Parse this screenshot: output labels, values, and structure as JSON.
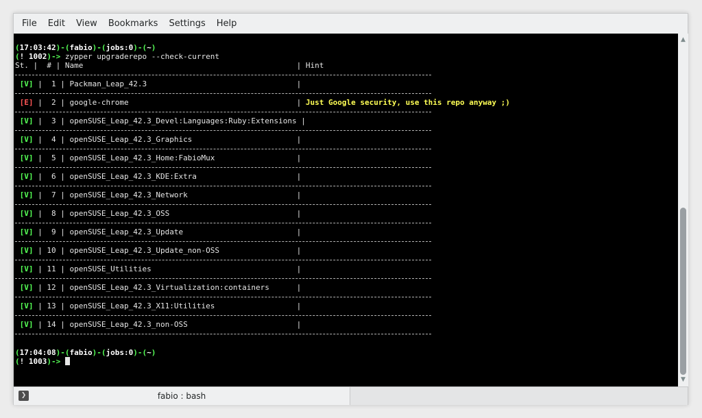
{
  "menu": [
    "File",
    "Edit",
    "View",
    "Bookmarks",
    "Settings",
    "Help"
  ],
  "terminal": {
    "prompt1": {
      "time": "17:03:42",
      "user": "fabio",
      "jobs": "jobs:0",
      "dir": "~",
      "hist": "! 1002",
      "command": "zypper upgraderepo --check-current"
    },
    "header": {
      "st": "St.",
      "num": "#",
      "name": "Name",
      "hint": "Hint"
    },
    "rows": [
      {
        "status": "[V]",
        "num": "1",
        "name": "Packman_Leap_42.3",
        "hint": ""
      },
      {
        "status": "[E]",
        "num": "2",
        "name": "google-chrome",
        "hint": "Just Google security, use this repo anyway ;)"
      },
      {
        "status": "[V]",
        "num": "3",
        "name": "openSUSE_Leap_42.3_Devel:Languages:Ruby:Extensions",
        "hint": ""
      },
      {
        "status": "[V]",
        "num": "4",
        "name": "openSUSE_Leap_42.3_Graphics",
        "hint": ""
      },
      {
        "status": "[V]",
        "num": "5",
        "name": "openSUSE_Leap_42.3_Home:FabioMux",
        "hint": ""
      },
      {
        "status": "[V]",
        "num": "6",
        "name": "openSUSE_Leap_42.3_KDE:Extra",
        "hint": ""
      },
      {
        "status": "[V]",
        "num": "7",
        "name": "openSUSE_Leap_42.3_Network",
        "hint": ""
      },
      {
        "status": "[V]",
        "num": "8",
        "name": "openSUSE_Leap_42.3_OSS",
        "hint": ""
      },
      {
        "status": "[V]",
        "num": "9",
        "name": "openSUSE_Leap_42.3_Update",
        "hint": ""
      },
      {
        "status": "[V]",
        "num": "10",
        "name": "openSUSE_Leap_42.3_Update_non-OSS",
        "hint": ""
      },
      {
        "status": "[V]",
        "num": "11",
        "name": "openSUSE_Utilities",
        "hint": ""
      },
      {
        "status": "[V]",
        "num": "12",
        "name": "openSUSE_Leap_42.3_Virtualization:containers",
        "hint": ""
      },
      {
        "status": "[V]",
        "num": "13",
        "name": "openSUSE_Leap_42.3_X11:Utilities",
        "hint": ""
      },
      {
        "status": "[V]",
        "num": "14",
        "name": "openSUSE_Leap_42.3_non-OSS",
        "hint": ""
      }
    ],
    "prompt2": {
      "time": "17:04:08",
      "user": "fabio",
      "jobs": "jobs:0",
      "dir": "~",
      "hist": "! 1003"
    }
  },
  "tab": {
    "label": "fabio : bash"
  },
  "colors": {
    "ok": "#55ff55",
    "error": "#ff5555",
    "hint": "#ffff55"
  }
}
